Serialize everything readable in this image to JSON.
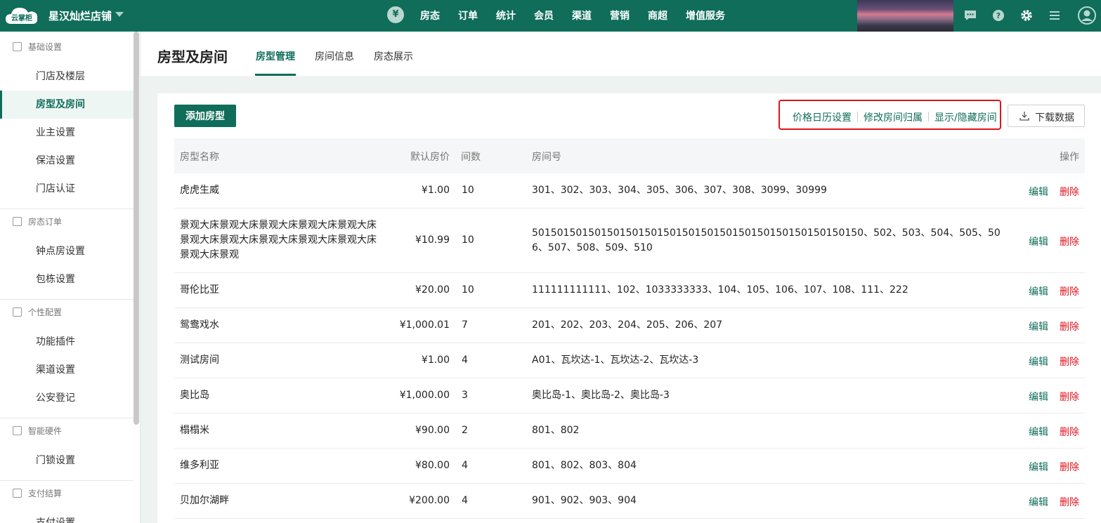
{
  "topbar": {
    "logo_text": "云掌柜",
    "store_name": "星汉灿烂店铺",
    "yen_symbol": "¥",
    "nav": [
      "房态",
      "订单",
      "统计",
      "会员",
      "渠道",
      "营销",
      "商超",
      "增值服务"
    ],
    "accent_color": "#0f6d5a"
  },
  "sidebar": {
    "groups": [
      {
        "title": "基础设置",
        "icon": "home-icon",
        "items": [
          "门店及楼层",
          "房型及房间",
          "业主设置",
          "保洁设置",
          "门店认证"
        ]
      },
      {
        "title": "房态订单",
        "icon": "calendar-icon",
        "items": [
          "钟点房设置",
          "包栋设置"
        ]
      },
      {
        "title": "个性配置",
        "icon": "config-icon",
        "items": [
          "功能插件",
          "渠道设置",
          "公安登记"
        ]
      },
      {
        "title": "智能硬件",
        "icon": "hardware-icon",
        "items": [
          "门锁设置"
        ]
      },
      {
        "title": "支付结算",
        "icon": "payment-icon",
        "items": [
          "支付设置"
        ]
      }
    ],
    "active_item": "房型及房间"
  },
  "header": {
    "title": "房型及房间",
    "tabs": [
      "房型管理",
      "房间信息",
      "房态展示"
    ],
    "active_tab": "房型管理"
  },
  "toolbar": {
    "add_label": "添加房型",
    "links": [
      "价格日历设置",
      "修改房间归属",
      "显示/隐藏房间"
    ],
    "download_label": "下载数据"
  },
  "table": {
    "columns": [
      "房型名称",
      "默认房价",
      "间数",
      "房间号",
      "操作"
    ],
    "edit_label": "编辑",
    "delete_label": "删除",
    "rows": [
      {
        "name": "虎虎生威",
        "price": "¥1.00",
        "count": "10",
        "rooms": "301、302、303、304、305、306、307、308、3099、30999"
      },
      {
        "name": "景观大床景观大床景观大床景观大床景观大床景观大床景观大床景观大床景观大床景观大床景观大床景观",
        "price": "¥10.99",
        "count": "10",
        "rooms": "50150150150150150150150150150150150150150150150150150、502、503、504、505、506、507、508、509、510"
      },
      {
        "name": "哥伦比亚",
        "price": "¥20.00",
        "count": "10",
        "rooms": "111111111111、102、1033333333、104、105、106、107、108、111、222"
      },
      {
        "name": "鸳鸯戏水",
        "price": "¥1,000.01",
        "count": "7",
        "rooms": "201、202、203、204、205、206、207"
      },
      {
        "name": "测试房间",
        "price": "¥1.00",
        "count": "4",
        "rooms": "A01、瓦坎达-1、瓦坎达-2、瓦坎达-3"
      },
      {
        "name": "奥比岛",
        "price": "¥1,000.00",
        "count": "3",
        "rooms": "奥比岛-1、奥比岛-2、奥比岛-3"
      },
      {
        "name": "榻榻米",
        "price": "¥90.00",
        "count": "2",
        "rooms": "801、802"
      },
      {
        "name": "维多利亚",
        "price": "¥80.00",
        "count": "4",
        "rooms": "801、802、803、804"
      },
      {
        "name": "贝加尔湖畔",
        "price": "¥200.00",
        "count": "4",
        "rooms": "901、902、903、904"
      }
    ]
  }
}
